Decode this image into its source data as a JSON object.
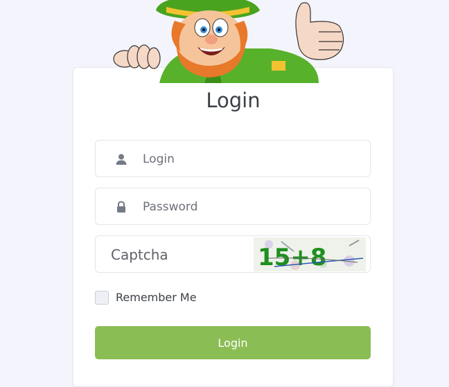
{
  "page": {
    "title": "Login",
    "background": "#f4f4fd"
  },
  "form": {
    "login_placeholder": "Login",
    "password_placeholder": "Password",
    "captcha_placeholder": "Captcha",
    "captcha_image_text": "15+8",
    "remember_label": "Remember Me",
    "remember_checked": false,
    "submit_label": "Login"
  },
  "colors": {
    "accent": "#8bbd55",
    "icon": "#757b86",
    "text": "#3b3f46"
  },
  "icons": [
    "leprechaun-mascot",
    "user-icon",
    "lock-icon"
  ]
}
